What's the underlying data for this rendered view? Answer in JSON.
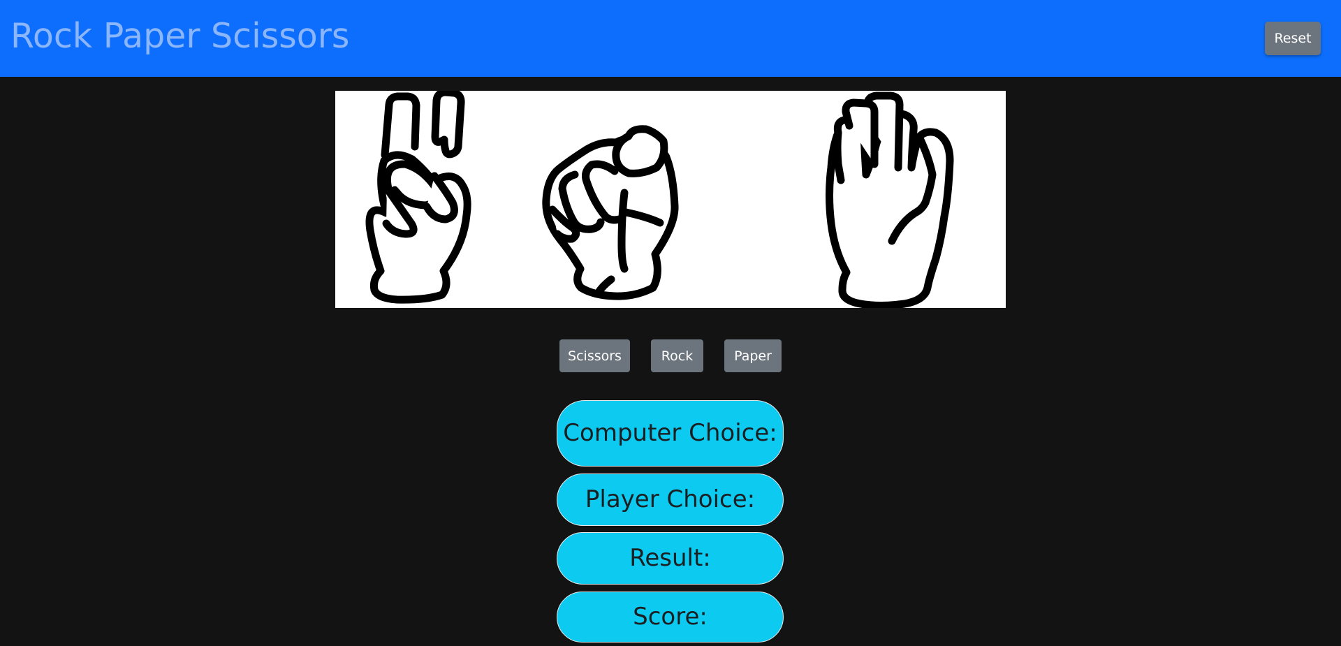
{
  "navbar": {
    "title": "Rock Paper Scissors",
    "reset_label": "Reset",
    "background": "#0d6efd"
  },
  "hands": {
    "items": [
      "scissors-hand-icon",
      "rock-fist-icon",
      "paper-palm-icon"
    ]
  },
  "choices": {
    "scissors_label": "Scissors",
    "rock_label": "Rock",
    "paper_label": "Paper"
  },
  "results": {
    "computer_choice_label": "Computer Choice:",
    "player_choice_label": "Player Choice:",
    "result_label": "Result:",
    "score_label": "Score:",
    "accent": "#0dcaf0"
  }
}
